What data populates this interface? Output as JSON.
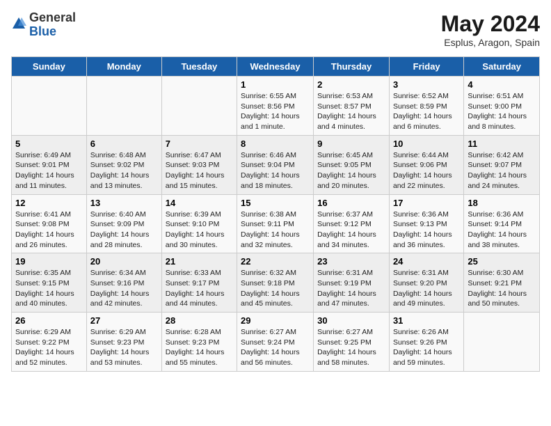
{
  "logo": {
    "general": "General",
    "blue": "Blue"
  },
  "title": "May 2024",
  "subtitle": "Esplus, Aragon, Spain",
  "headers": [
    "Sunday",
    "Monday",
    "Tuesday",
    "Wednesday",
    "Thursday",
    "Friday",
    "Saturday"
  ],
  "weeks": [
    [
      {
        "day": "",
        "info": ""
      },
      {
        "day": "",
        "info": ""
      },
      {
        "day": "",
        "info": ""
      },
      {
        "day": "1",
        "info": "Sunrise: 6:55 AM\nSunset: 8:56 PM\nDaylight: 14 hours\nand 1 minute."
      },
      {
        "day": "2",
        "info": "Sunrise: 6:53 AM\nSunset: 8:57 PM\nDaylight: 14 hours\nand 4 minutes."
      },
      {
        "day": "3",
        "info": "Sunrise: 6:52 AM\nSunset: 8:59 PM\nDaylight: 14 hours\nand 6 minutes."
      },
      {
        "day": "4",
        "info": "Sunrise: 6:51 AM\nSunset: 9:00 PM\nDaylight: 14 hours\nand 8 minutes."
      }
    ],
    [
      {
        "day": "5",
        "info": "Sunrise: 6:49 AM\nSunset: 9:01 PM\nDaylight: 14 hours\nand 11 minutes."
      },
      {
        "day": "6",
        "info": "Sunrise: 6:48 AM\nSunset: 9:02 PM\nDaylight: 14 hours\nand 13 minutes."
      },
      {
        "day": "7",
        "info": "Sunrise: 6:47 AM\nSunset: 9:03 PM\nDaylight: 14 hours\nand 15 minutes."
      },
      {
        "day": "8",
        "info": "Sunrise: 6:46 AM\nSunset: 9:04 PM\nDaylight: 14 hours\nand 18 minutes."
      },
      {
        "day": "9",
        "info": "Sunrise: 6:45 AM\nSunset: 9:05 PM\nDaylight: 14 hours\nand 20 minutes."
      },
      {
        "day": "10",
        "info": "Sunrise: 6:44 AM\nSunset: 9:06 PM\nDaylight: 14 hours\nand 22 minutes."
      },
      {
        "day": "11",
        "info": "Sunrise: 6:42 AM\nSunset: 9:07 PM\nDaylight: 14 hours\nand 24 minutes."
      }
    ],
    [
      {
        "day": "12",
        "info": "Sunrise: 6:41 AM\nSunset: 9:08 PM\nDaylight: 14 hours\nand 26 minutes."
      },
      {
        "day": "13",
        "info": "Sunrise: 6:40 AM\nSunset: 9:09 PM\nDaylight: 14 hours\nand 28 minutes."
      },
      {
        "day": "14",
        "info": "Sunrise: 6:39 AM\nSunset: 9:10 PM\nDaylight: 14 hours\nand 30 minutes."
      },
      {
        "day": "15",
        "info": "Sunrise: 6:38 AM\nSunset: 9:11 PM\nDaylight: 14 hours\nand 32 minutes."
      },
      {
        "day": "16",
        "info": "Sunrise: 6:37 AM\nSunset: 9:12 PM\nDaylight: 14 hours\nand 34 minutes."
      },
      {
        "day": "17",
        "info": "Sunrise: 6:36 AM\nSunset: 9:13 PM\nDaylight: 14 hours\nand 36 minutes."
      },
      {
        "day": "18",
        "info": "Sunrise: 6:36 AM\nSunset: 9:14 PM\nDaylight: 14 hours\nand 38 minutes."
      }
    ],
    [
      {
        "day": "19",
        "info": "Sunrise: 6:35 AM\nSunset: 9:15 PM\nDaylight: 14 hours\nand 40 minutes."
      },
      {
        "day": "20",
        "info": "Sunrise: 6:34 AM\nSunset: 9:16 PM\nDaylight: 14 hours\nand 42 minutes."
      },
      {
        "day": "21",
        "info": "Sunrise: 6:33 AM\nSunset: 9:17 PM\nDaylight: 14 hours\nand 44 minutes."
      },
      {
        "day": "22",
        "info": "Sunrise: 6:32 AM\nSunset: 9:18 PM\nDaylight: 14 hours\nand 45 minutes."
      },
      {
        "day": "23",
        "info": "Sunrise: 6:31 AM\nSunset: 9:19 PM\nDaylight: 14 hours\nand 47 minutes."
      },
      {
        "day": "24",
        "info": "Sunrise: 6:31 AM\nSunset: 9:20 PM\nDaylight: 14 hours\nand 49 minutes."
      },
      {
        "day": "25",
        "info": "Sunrise: 6:30 AM\nSunset: 9:21 PM\nDaylight: 14 hours\nand 50 minutes."
      }
    ],
    [
      {
        "day": "26",
        "info": "Sunrise: 6:29 AM\nSunset: 9:22 PM\nDaylight: 14 hours\nand 52 minutes."
      },
      {
        "day": "27",
        "info": "Sunrise: 6:29 AM\nSunset: 9:23 PM\nDaylight: 14 hours\nand 53 minutes."
      },
      {
        "day": "28",
        "info": "Sunrise: 6:28 AM\nSunset: 9:23 PM\nDaylight: 14 hours\nand 55 minutes."
      },
      {
        "day": "29",
        "info": "Sunrise: 6:27 AM\nSunset: 9:24 PM\nDaylight: 14 hours\nand 56 minutes."
      },
      {
        "day": "30",
        "info": "Sunrise: 6:27 AM\nSunset: 9:25 PM\nDaylight: 14 hours\nand 58 minutes."
      },
      {
        "day": "31",
        "info": "Sunrise: 6:26 AM\nSunset: 9:26 PM\nDaylight: 14 hours\nand 59 minutes."
      },
      {
        "day": "",
        "info": ""
      }
    ]
  ]
}
